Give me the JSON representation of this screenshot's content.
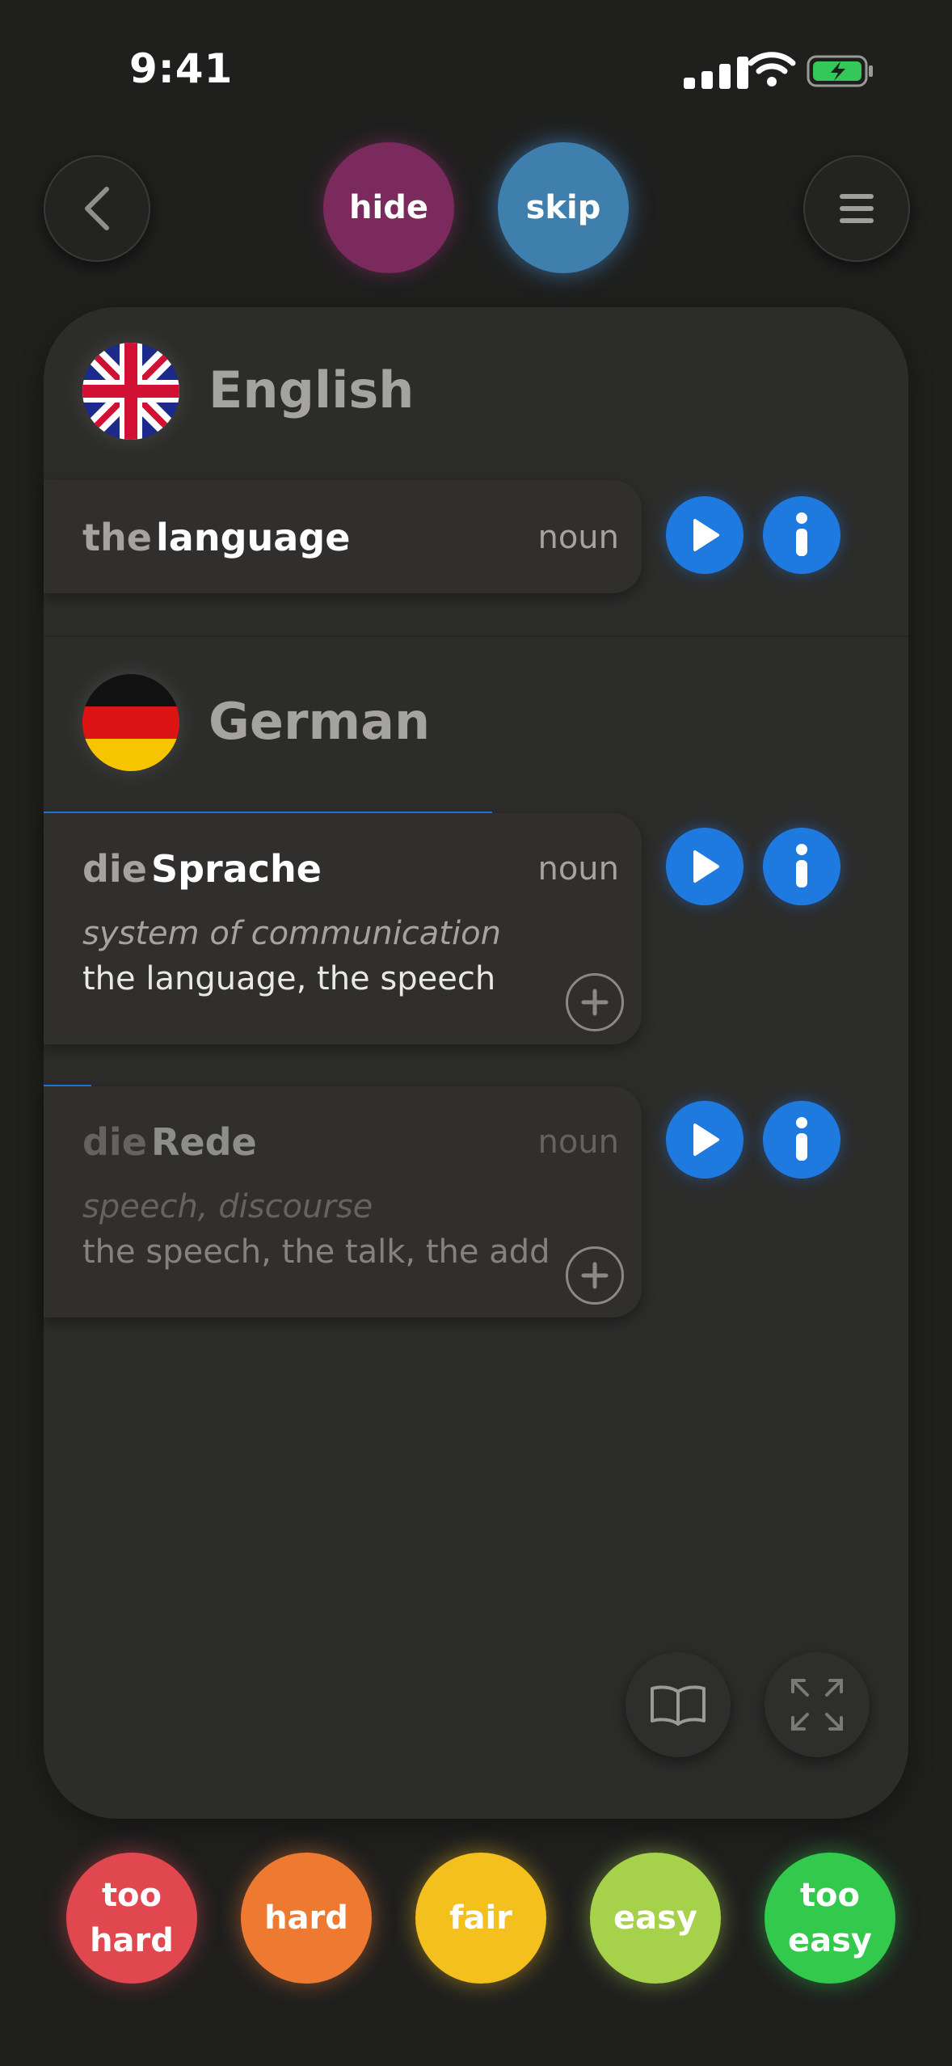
{
  "status_bar": {
    "time": "9:41"
  },
  "top_bar": {
    "hide_label": "hide",
    "skip_label": "skip"
  },
  "source": {
    "language": "English",
    "entry": {
      "article": "the",
      "word": "language",
      "pos": "noun"
    }
  },
  "target": {
    "language": "German",
    "entries": [
      {
        "article": "die",
        "word": "Sprache",
        "pos": "noun",
        "definition": "system of communication",
        "translation": "the language, the speech",
        "progress": 0.75
      },
      {
        "article": "die",
        "word": "Rede",
        "pos": "noun",
        "definition": "speech, discourse",
        "translation": "the speech, the talk, the add...",
        "progress": 0.08
      }
    ]
  },
  "ratings": [
    "too\nhard",
    "hard",
    "fair",
    "easy",
    "too\neasy"
  ],
  "colors": {
    "hide": "#7a2a5c",
    "skip": "#3f7fae",
    "accent_blue": "#1f7ae0",
    "too_hard": "#e0474f",
    "hard": "#ee7a32",
    "fair": "#f3c01d",
    "easy": "#a6d14a",
    "too_easy": "#32c94c"
  },
  "icons": [
    "back-icon",
    "menu-icon",
    "play-icon",
    "info-icon",
    "plus-icon",
    "book-icon",
    "fullscreen-icon"
  ]
}
